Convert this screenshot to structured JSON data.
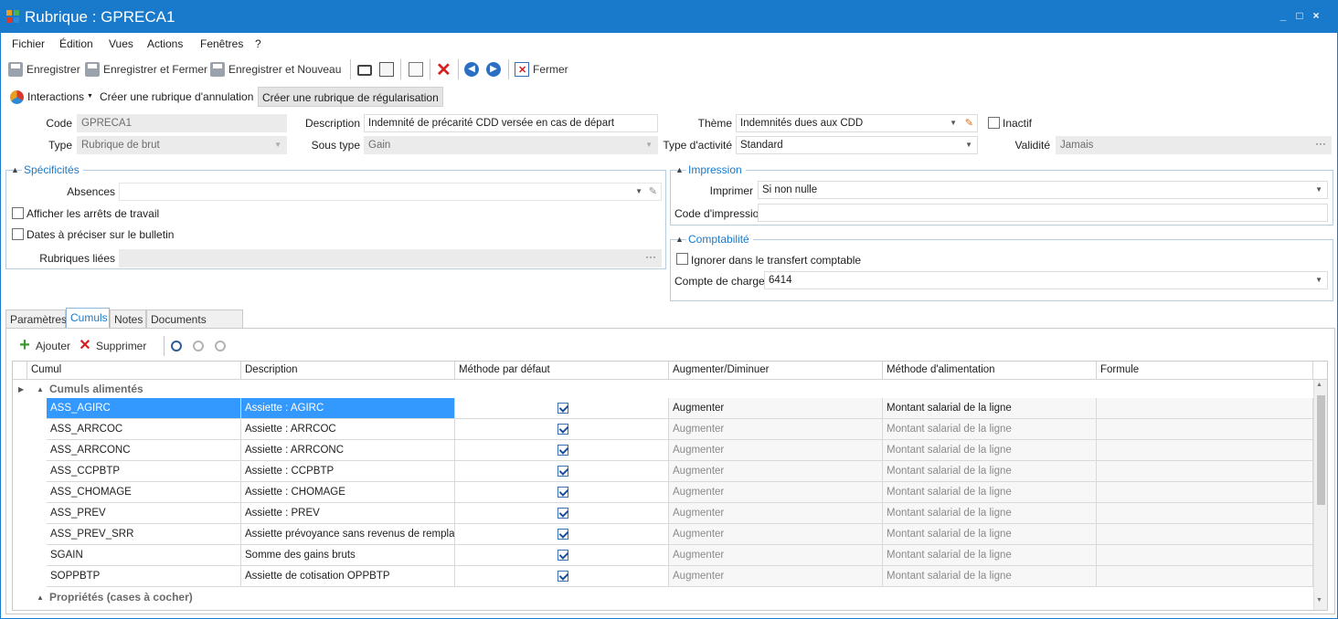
{
  "window": {
    "title": "Rubrique : GPRECA1",
    "controls": [
      "_",
      "□",
      "×"
    ]
  },
  "menu": [
    "Fichier",
    "Édition",
    "Vues",
    "Actions",
    "Fenêtres",
    "?"
  ],
  "toolbar": {
    "save": "Enregistrer",
    "save_close": "Enregistrer et Fermer",
    "save_new": "Enregistrer et Nouveau",
    "close": "Fermer"
  },
  "actions": {
    "interactions": "Interactions",
    "annulation": "Créer une rubrique d'annulation",
    "regularisation": "Créer une rubrique de régularisation"
  },
  "form": {
    "code_label": "Code",
    "code": "GPRECA1",
    "description_label": "Description",
    "description": "Indemnité de précarité CDD versée en cas de départ",
    "theme_label": "Thème",
    "theme": "Indemnités dues aux CDD",
    "inactif_label": "Inactif",
    "type_label": "Type",
    "type": "Rubrique de brut",
    "soustype_label": "Sous type",
    "soustype": "Gain",
    "typeactivite_label": "Type d'activité",
    "typeactivite": "Standard",
    "validite_label": "Validité",
    "validite": "Jamais"
  },
  "specificites": {
    "title": "Spécificités",
    "absences_label": "Absences",
    "arrets_label": "Afficher les arrêts de travail",
    "dates_label": "Dates à préciser sur le bulletin",
    "liees_label": "Rubriques liées"
  },
  "impression": {
    "title": "Impression",
    "imprimer_label": "Imprimer",
    "imprimer": "Si non nulle",
    "code_label": "Code d'impression"
  },
  "comptabilite": {
    "title": "Comptabilité",
    "ignorer_label": "Ignorer dans le transfert comptable",
    "compte_label": "Compte de charges",
    "compte": "6414"
  },
  "tabs": [
    "Paramètres",
    "Cumuls",
    "Notes",
    "Documents associés"
  ],
  "grid_toolbar": {
    "add": "Ajouter",
    "delete": "Supprimer"
  },
  "grid": {
    "columns": [
      "Cumul",
      "Description",
      "Méthode par défaut",
      "Augmenter/Diminuer",
      "Méthode d'alimentation",
      "Formule"
    ],
    "group1": "Cumuls alimentés",
    "group2": "Propriétés (cases à cocher)",
    "rows": [
      {
        "cumul": "ASS_AGIRC",
        "desc": "Assiette : AGIRC",
        "aug": "Augmenter",
        "meth": "Montant salarial de la ligne"
      },
      {
        "cumul": "ASS_ARRCOC",
        "desc": "Assiette : ARRCOC",
        "aug": "Augmenter",
        "meth": "Montant salarial de la ligne"
      },
      {
        "cumul": "ASS_ARRCONC",
        "desc": "Assiette : ARRCONC",
        "aug": "Augmenter",
        "meth": "Montant salarial de la ligne"
      },
      {
        "cumul": "ASS_CCPBTP",
        "desc": "Assiette : CCPBTP",
        "aug": "Augmenter",
        "meth": "Montant salarial de la ligne"
      },
      {
        "cumul": "ASS_CHOMAGE",
        "desc": "Assiette : CHOMAGE",
        "aug": "Augmenter",
        "meth": "Montant salarial de la ligne"
      },
      {
        "cumul": "ASS_PREV",
        "desc": "Assiette : PREV",
        "aug": "Augmenter",
        "meth": "Montant salarial de la ligne"
      },
      {
        "cumul": "ASS_PREV_SRR",
        "desc": "Assiette prévoyance sans revenus de rempla...",
        "aug": "Augmenter",
        "meth": "Montant salarial de la ligne"
      },
      {
        "cumul": "SGAIN",
        "desc": "Somme des gains bruts",
        "aug": "Augmenter",
        "meth": "Montant salarial de la ligne"
      },
      {
        "cumul": "SOPPBTP",
        "desc": "Assiette de cotisation OPPBTP",
        "aug": "Augmenter",
        "meth": "Montant salarial de la ligne"
      }
    ]
  },
  "colors": {
    "accent": "#1979ca",
    "selection": "#3399ff"
  }
}
